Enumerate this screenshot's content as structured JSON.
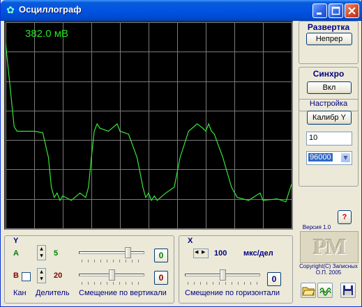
{
  "window": {
    "title": "Осциллограф"
  },
  "scope": {
    "readout": "382.0 мВ",
    "colors": {
      "background": "#000000",
      "grid": "#7a7a7a",
      "trace": "#39e639",
      "readout": "#22e022"
    }
  },
  "chart_data": {
    "type": "line",
    "x": [
      0,
      0.3,
      0.4,
      1.0,
      1.3,
      1.5,
      1.6,
      1.7,
      1.8,
      1.9,
      2.0,
      2.3,
      2.6,
      2.8,
      2.9,
      3.0,
      3.1,
      3.2,
      3.3,
      3.6,
      3.9,
      4.0,
      4.3,
      4.6,
      4.8,
      4.9,
      5.0,
      5.1,
      5.2,
      5.3,
      5.6,
      5.9,
      6.1,
      6.4,
      6.7,
      6.9,
      7.0,
      7.1,
      7.2,
      7.3,
      7.6,
      7.9,
      8.1,
      8.5,
      8.9,
      9.0,
      9.5,
      9.8,
      10.0
    ],
    "y": [
      6.3,
      3.45,
      3.3,
      3.3,
      3.25,
      2.4,
      1.4,
      1.05,
      1.2,
      0.95,
      1.1,
      0.95,
      1.2,
      1.05,
      1.4,
      2.4,
      3.3,
      3.55,
      3.4,
      3.3,
      3.55,
      3.3,
      3.2,
      2.4,
      1.4,
      1.05,
      1.2,
      0.95,
      1.1,
      0.95,
      1.2,
      1.4,
      2.4,
      3.3,
      3.55,
      3.4,
      3.3,
      3.55,
      3.3,
      3.2,
      2.4,
      1.4,
      1.05,
      0.95,
      1.2,
      0.95,
      1.0,
      0.9,
      1.5
    ],
    "xlim": [
      0,
      10
    ],
    "ylim": [
      0,
      7
    ],
    "grid": true
  },
  "razvertka": {
    "title": "Развертка",
    "button": "Непрер"
  },
  "sinhro": {
    "title": "Синхро",
    "button": "Вкл"
  },
  "nastroyka": {
    "title": "Настройка",
    "calib_button": "Калибр Y",
    "value": "10",
    "rate": "96000"
  },
  "help_label": "?",
  "version": "Версия 1.0",
  "logo": "PM",
  "copyright": "Copyright(C) Записных О.П. 2005",
  "y_section": {
    "title": "Y",
    "ch_a": "A",
    "ch_b": "B",
    "a_value": "5",
    "b_value": "20",
    "a_offset": "0",
    "b_offset": "0",
    "kan": "Кан",
    "delitel": "Делитель",
    "shift_label": "Смещение по вертикали",
    "a_slider_level": 0.78,
    "b_slider_level": 0.5,
    "colors": {
      "a": "#008000",
      "b": "#800000"
    }
  },
  "x_section": {
    "title": "X",
    "time_value": "100",
    "unit": "мкс/дел",
    "offset": "0",
    "shift_label": "Смещение по горизонтали",
    "slider_level": 0.5
  },
  "icons": [
    "open-folder-icon",
    "wave-icon",
    "save-disk-icon"
  ]
}
